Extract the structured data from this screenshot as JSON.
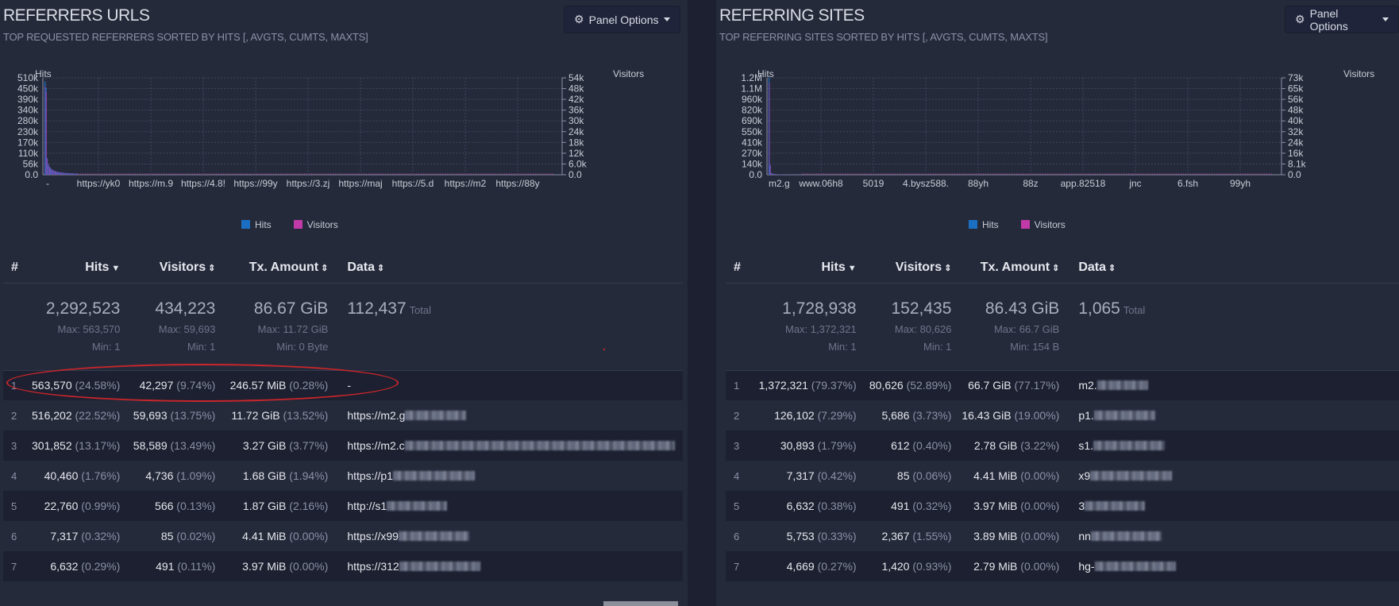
{
  "colors": {
    "hits": "#1b6fc2",
    "visitors": "#c13aa7",
    "annotation": "#c8262b"
  },
  "left": {
    "title": "REFERRERS URLS",
    "subtitle": "TOP REQUESTED REFERRERS SORTED BY HITS [, AVGTS, CUMTS, MAXTS]",
    "panel_options": "Panel Options",
    "chart": {
      "hits_label": "Hits",
      "visitors_label": "Visitors",
      "y_left_ticks": [
        "510k",
        "450k",
        "390k",
        "340k",
        "280k",
        "230k",
        "170k",
        "110k",
        "56k",
        "0.0"
      ],
      "y_right_ticks": [
        "54k",
        "48k",
        "42k",
        "36k",
        "30k",
        "24k",
        "18k",
        "12k",
        "6.0k",
        "0.0"
      ],
      "x_ticks": [
        "-",
        "https://yk0",
        "https://m.9",
        "https://4.8!",
        "https://99y",
        "https://3.zj",
        "https://maj",
        "https://5.d",
        "https://m2",
        "https://88y"
      ],
      "legend": [
        "Hits",
        "Visitors"
      ]
    },
    "columns": [
      "#",
      "Hits",
      "Visitors",
      "Tx. Amount",
      "Data"
    ],
    "summary": {
      "hits": "2,292,523",
      "hits_max": "Max: 563,570",
      "hits_min": "Min: 1",
      "visitors": "434,223",
      "visitors_max": "Max: 59,693",
      "visitors_min": "Min: 1",
      "tx": "86.67 GiB",
      "tx_max": "Max: 11.72 GiB",
      "tx_min": "Min: 0 Byte",
      "data_total": "112,437",
      "total_word": "Total"
    },
    "rows": [
      {
        "n": "1",
        "hits": "563,570",
        "hits_pct": "(24.58%)",
        "vis": "42,297",
        "vis_pct": "(9.74%)",
        "tx": "246.57 MiB",
        "tx_pct": "(0.28%)",
        "data": "-"
      },
      {
        "n": "2",
        "hits": "516,202",
        "hits_pct": "(22.52%)",
        "vis": "59,693",
        "vis_pct": "(13.75%)",
        "tx": "11.72 GiB",
        "tx_pct": "(13.52%)",
        "data": "https://m2.g"
      },
      {
        "n": "3",
        "hits": "301,852",
        "hits_pct": "(13.17%)",
        "vis": "58,589",
        "vis_pct": "(13.49%)",
        "tx": "3.27 GiB",
        "tx_pct": "(3.77%)",
        "data": "https://m2.c"
      },
      {
        "n": "4",
        "hits": "40,460",
        "hits_pct": "(1.76%)",
        "vis": "4,736",
        "vis_pct": "(1.09%)",
        "tx": "1.68 GiB",
        "tx_pct": "(1.94%)",
        "data": "https://p1"
      },
      {
        "n": "5",
        "hits": "22,760",
        "hits_pct": "(0.99%)",
        "vis": "566",
        "vis_pct": "(0.13%)",
        "tx": "1.87 GiB",
        "tx_pct": "(2.16%)",
        "data": "http://s1"
      },
      {
        "n": "6",
        "hits": "7,317",
        "hits_pct": "(0.32%)",
        "vis": "85",
        "vis_pct": "(0.02%)",
        "tx": "4.41 MiB",
        "tx_pct": "(0.00%)",
        "data": "https://x99"
      },
      {
        "n": "7",
        "hits": "6,632",
        "hits_pct": "(0.29%)",
        "vis": "491",
        "vis_pct": "(0.11%)",
        "tx": "3.97 MiB",
        "tx_pct": "(0.00%)",
        "data": "https://312"
      }
    ]
  },
  "right": {
    "title": "REFERRING SITES",
    "subtitle": "TOP REFERRING SITES SORTED BY HITS [, AVGTS, CUMTS, MAXTS]",
    "panel_options": "Panel Options",
    "chart": {
      "hits_label": "Hits",
      "visitors_label": "Visitors",
      "y_left_ticks": [
        "1.2M",
        "1.1M",
        "960k",
        "820k",
        "690k",
        "550k",
        "410k",
        "270k",
        "140k",
        "0.0"
      ],
      "y_right_ticks": [
        "73k",
        "65k",
        "56k",
        "48k",
        "40k",
        "32k",
        "24k",
        "16k",
        "8.1k",
        "0.0"
      ],
      "x_ticks": [
        "m2.g",
        "www.06h8",
        "5019",
        "4.bysz588.",
        "88yh",
        "88z",
        "app.82518",
        "jnc",
        "6.fsh",
        "99yh"
      ],
      "legend": [
        "Hits",
        "Visitors"
      ]
    },
    "columns": [
      "#",
      "Hits",
      "Visitors",
      "Tx. Amount",
      "Data"
    ],
    "summary": {
      "hits": "1,728,938",
      "hits_max": "Max: 1,372,321",
      "hits_min": "Min: 1",
      "visitors": "152,435",
      "visitors_max": "Max: 80,626",
      "visitors_min": "Min: 1",
      "tx": "86.43 GiB",
      "tx_max": "Max: 66.7 GiB",
      "tx_min": "Min: 154 B",
      "data_total": "1,065",
      "total_word": "Total"
    },
    "rows": [
      {
        "n": "1",
        "hits": "1,372,321",
        "hits_pct": "(79.37%)",
        "vis": "80,626",
        "vis_pct": "(52.89%)",
        "tx": "66.7 GiB",
        "tx_pct": "(77.17%)",
        "data": "m2."
      },
      {
        "n": "2",
        "hits": "126,102",
        "hits_pct": "(7.29%)",
        "vis": "5,686",
        "vis_pct": "(3.73%)",
        "tx": "16.43 GiB",
        "tx_pct": "(19.00%)",
        "data": "p1."
      },
      {
        "n": "3",
        "hits": "30,893",
        "hits_pct": "(1.79%)",
        "vis": "612",
        "vis_pct": "(0.40%)",
        "tx": "2.78 GiB",
        "tx_pct": "(3.22%)",
        "data": "s1."
      },
      {
        "n": "4",
        "hits": "7,317",
        "hits_pct": "(0.42%)",
        "vis": "85",
        "vis_pct": "(0.06%)",
        "tx": "4.41 MiB",
        "tx_pct": "(0.00%)",
        "data": "x9"
      },
      {
        "n": "5",
        "hits": "6,632",
        "hits_pct": "(0.38%)",
        "vis": "491",
        "vis_pct": "(0.32%)",
        "tx": "3.97 MiB",
        "tx_pct": "(0.00%)",
        "data": "3"
      },
      {
        "n": "6",
        "hits": "5,753",
        "hits_pct": "(0.33%)",
        "vis": "2,367",
        "vis_pct": "(1.55%)",
        "tx": "3.89 MiB",
        "tx_pct": "(0.00%)",
        "data": "nn"
      },
      {
        "n": "7",
        "hits": "4,669",
        "hits_pct": "(0.27%)",
        "vis": "1,420",
        "vis_pct": "(0.93%)",
        "tx": "2.79 MiB",
        "tx_pct": "(0.00%)",
        "data": "hg-"
      }
    ]
  }
}
